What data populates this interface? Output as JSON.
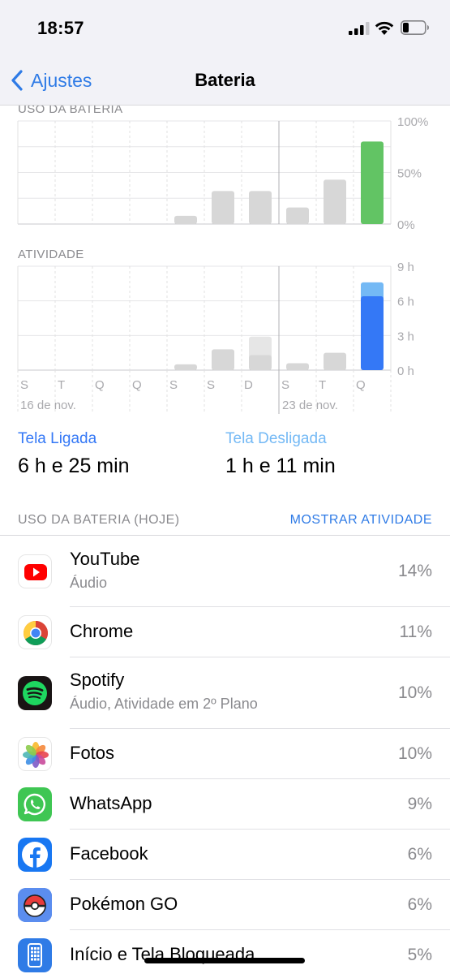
{
  "status_bar": {
    "time": "18:57"
  },
  "nav": {
    "back_label": "Ajustes",
    "title": "Bateria"
  },
  "charts": {
    "battery_label": "USO DA BATERIA",
    "activity_label": "ATIVIDADE",
    "battery_ticks": [
      "100%",
      "50%",
      "0%"
    ],
    "activity_ticks": [
      "9 h",
      "6 h",
      "3 h",
      "0 h"
    ],
    "day_labels": [
      "S",
      "T",
      "Q",
      "Q",
      "S",
      "S",
      "D",
      "S",
      "T",
      "Q"
    ],
    "date_labels": [
      "16 de nov.",
      "23 de nov."
    ]
  },
  "chart_data": [
    {
      "type": "bar",
      "title": "USO DA BATERIA",
      "categories": [
        "S",
        "T",
        "Q",
        "Q",
        "S",
        "S",
        "D",
        "S",
        "T",
        "Q"
      ],
      "values": [
        0,
        0,
        0,
        0,
        8,
        32,
        32,
        16,
        43,
        80
      ],
      "ylim": [
        0,
        100
      ],
      "yticks": [
        "100%",
        "50%",
        "0%"
      ],
      "colors": {
        "normal": "#d7d7d7",
        "today": "#62c464"
      }
    },
    {
      "type": "bar",
      "title": "ATIVIDADE",
      "categories": [
        "S",
        "T",
        "Q",
        "Q",
        "S",
        "S",
        "D",
        "S",
        "T",
        "Q"
      ],
      "series": [
        {
          "values": [
            0,
            0,
            0,
            0,
            0.5,
            1.8,
            1.3,
            0.6,
            1.5,
            6.4
          ]
        },
        {
          "values": [
            0,
            0,
            0,
            0,
            0,
            0,
            1.6,
            0,
            0,
            1.2
          ]
        }
      ],
      "ylim": [
        0,
        9
      ],
      "yticks": [
        "9 h",
        "6 h",
        "3 h",
        "0 h"
      ],
      "colors": {
        "normal": "#d7d7d7",
        "normal_light": "#e6e6e6",
        "today": "#3478f6",
        "today_light": "#74b9f5"
      }
    }
  ],
  "screen": {
    "on_label": "Tela Ligada",
    "on_value": "6 h e 25 min",
    "on_color": "#3478f6",
    "off_label": "Tela Desligada",
    "off_value": "1 h e 11 min",
    "off_color": "#74b9f5"
  },
  "section": {
    "title": "USO DA BATERIA (HOJE)",
    "action": "MOSTRAR ATIVIDADE"
  },
  "apps": [
    {
      "name": "YouTube",
      "sub": "Áudio",
      "pct": "14%",
      "icon": "youtube-icon"
    },
    {
      "name": "Chrome",
      "sub": "",
      "pct": "11%",
      "icon": "chrome-icon"
    },
    {
      "name": "Spotify",
      "sub": "Áudio, Atividade em 2º Plano",
      "pct": "10%",
      "icon": "spotify-icon"
    },
    {
      "name": "Fotos",
      "sub": "",
      "pct": "10%",
      "icon": "photos-icon"
    },
    {
      "name": "WhatsApp",
      "sub": "",
      "pct": "9%",
      "icon": "whatsapp-icon"
    },
    {
      "name": "Facebook",
      "sub": "",
      "pct": "6%",
      "icon": "facebook-icon"
    },
    {
      "name": "Pokémon GO",
      "sub": "",
      "pct": "6%",
      "icon": "pokemon-go-icon"
    },
    {
      "name": "Início e Tela Bloqueada",
      "sub": "",
      "pct": "5%",
      "icon": "home-lock-screen-icon"
    }
  ]
}
